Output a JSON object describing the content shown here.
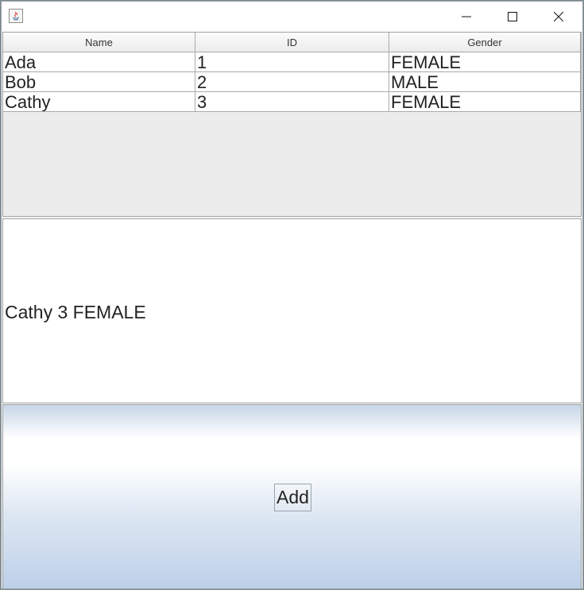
{
  "window": {
    "title": "",
    "icon": "java-icon"
  },
  "titlebar": {
    "minimize_icon": "minimize-icon",
    "maximize_icon": "maximize-icon",
    "close_icon": "close-icon"
  },
  "table": {
    "columns": [
      "Name",
      "ID",
      "Gender"
    ],
    "rows": [
      [
        "Ada",
        "1",
        "FEMALE"
      ],
      [
        "Bob",
        "2",
        "MALE"
      ],
      [
        "Cathy",
        "3",
        "FEMALE"
      ]
    ]
  },
  "detail": {
    "text": "Cathy 3 FEMALE"
  },
  "actions": {
    "add_label": "Add"
  },
  "colors": {
    "panel_gray": "#ececec",
    "button_panel_gradient_bottom": "#bdd0e8"
  }
}
